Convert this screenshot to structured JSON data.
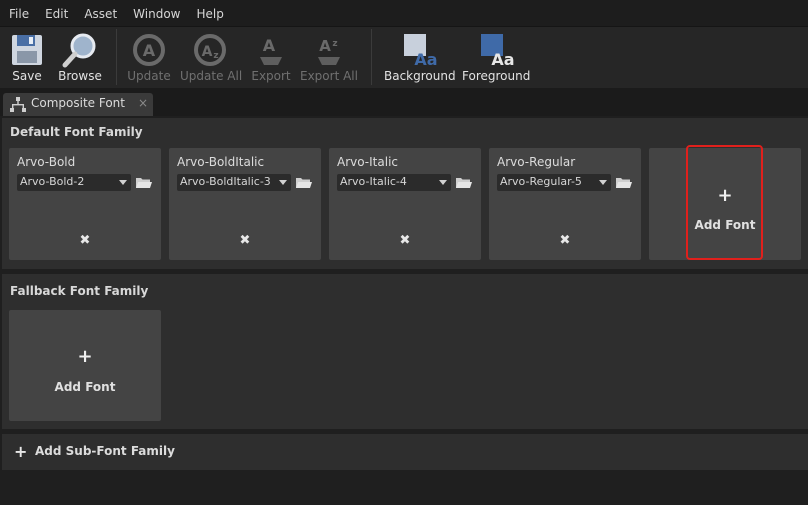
{
  "menu": [
    "File",
    "Edit",
    "Asset",
    "Window",
    "Help"
  ],
  "toolbar": {
    "save": "Save",
    "browse": "Browse",
    "update": "Update",
    "update_all": "Update All",
    "export": "Export",
    "export_all": "Export All",
    "background": "Background",
    "foreground": "Foreground"
  },
  "tab": {
    "label": "Composite Font",
    "close": "×"
  },
  "default_family": {
    "title": "Default Font Family",
    "fonts": [
      {
        "name": "Arvo-Bold",
        "asset": "Arvo-Bold-2"
      },
      {
        "name": "Arvo-BoldItalic",
        "asset": "Arvo-BoldItalic-3"
      },
      {
        "name": "Arvo-Italic",
        "asset": "Arvo-Italic-4"
      },
      {
        "name": "Arvo-Regular",
        "asset": "Arvo-Regular-5"
      }
    ],
    "add_label": "Add Font"
  },
  "fallback_family": {
    "title": "Fallback Font Family",
    "add_label": "Add Font"
  },
  "sub_font": {
    "label": "Add Sub-Font Family"
  },
  "colors": {
    "highlight": "#e0201c",
    "panel": "#2e2e2e",
    "card": "#444444"
  }
}
